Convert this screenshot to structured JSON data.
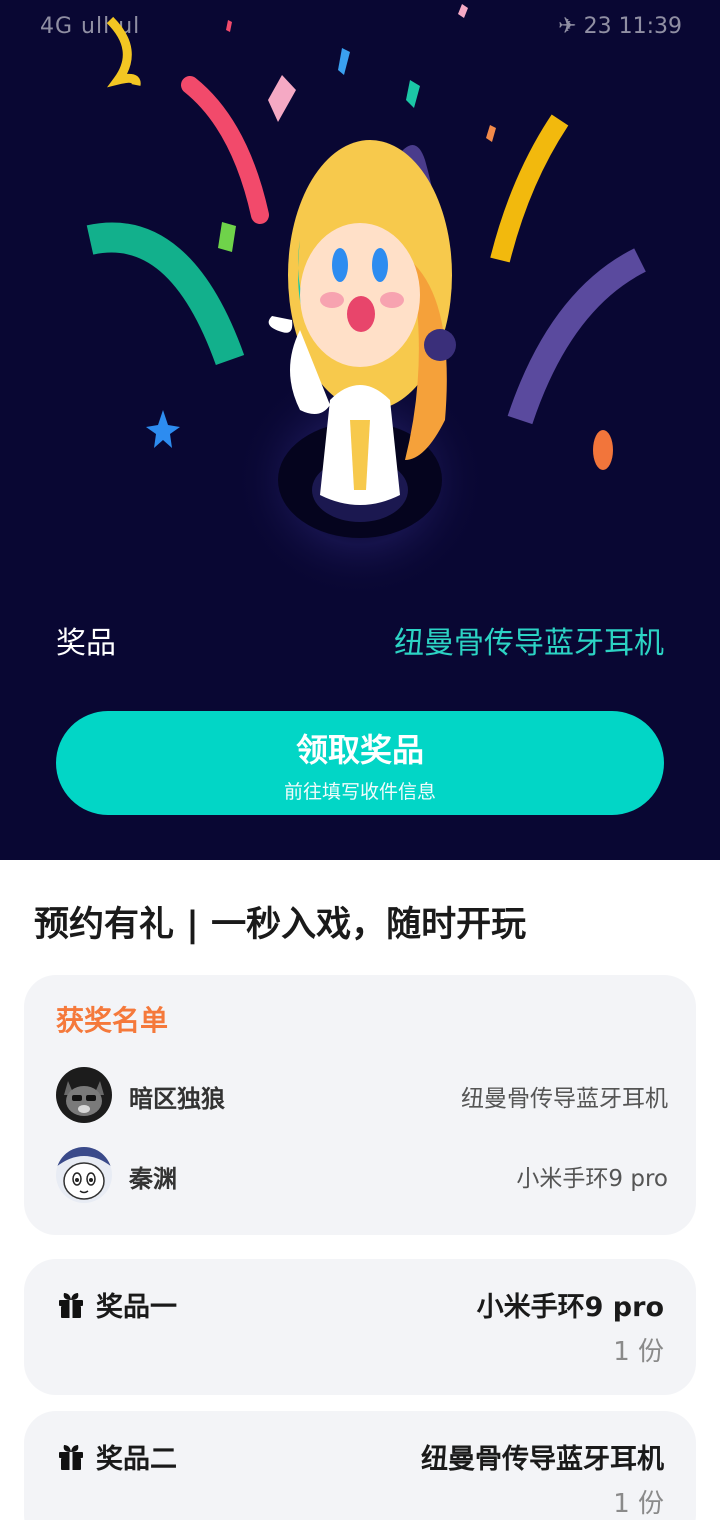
{
  "status_bar": {
    "left": "4G ull ul",
    "right": "✈ 23 11:39"
  },
  "hero": {
    "prize_label": "奖品",
    "prize_value": "纽曼骨传导蓝牙耳机",
    "claim_button": {
      "title": "领取奖品",
      "subtitle": "前往填写收件信息"
    }
  },
  "section": {
    "title": "预约有礼 | 一秒入戏，随时开玩"
  },
  "winners": {
    "title": "获奖名单",
    "items": [
      {
        "name": "暗区独狼",
        "prize": "纽曼骨传导蓝牙耳机",
        "avatar_icon": "cat-avatar-icon"
      },
      {
        "name": "秦渊",
        "prize": "小米手环9 pro",
        "avatar_icon": "cartoon-face-avatar-icon"
      }
    ]
  },
  "prizes": [
    {
      "label": "奖品一",
      "title": "小米手环9 pro",
      "count": "1 份"
    },
    {
      "label": "奖品二",
      "title": "纽曼骨传导蓝牙耳机",
      "count": "1 份"
    }
  ],
  "colors": {
    "hero_bg": "#090733",
    "accent_teal": "#02d6c6",
    "winners_title": "#f5793b",
    "card_bg": "#f3f4f7"
  }
}
